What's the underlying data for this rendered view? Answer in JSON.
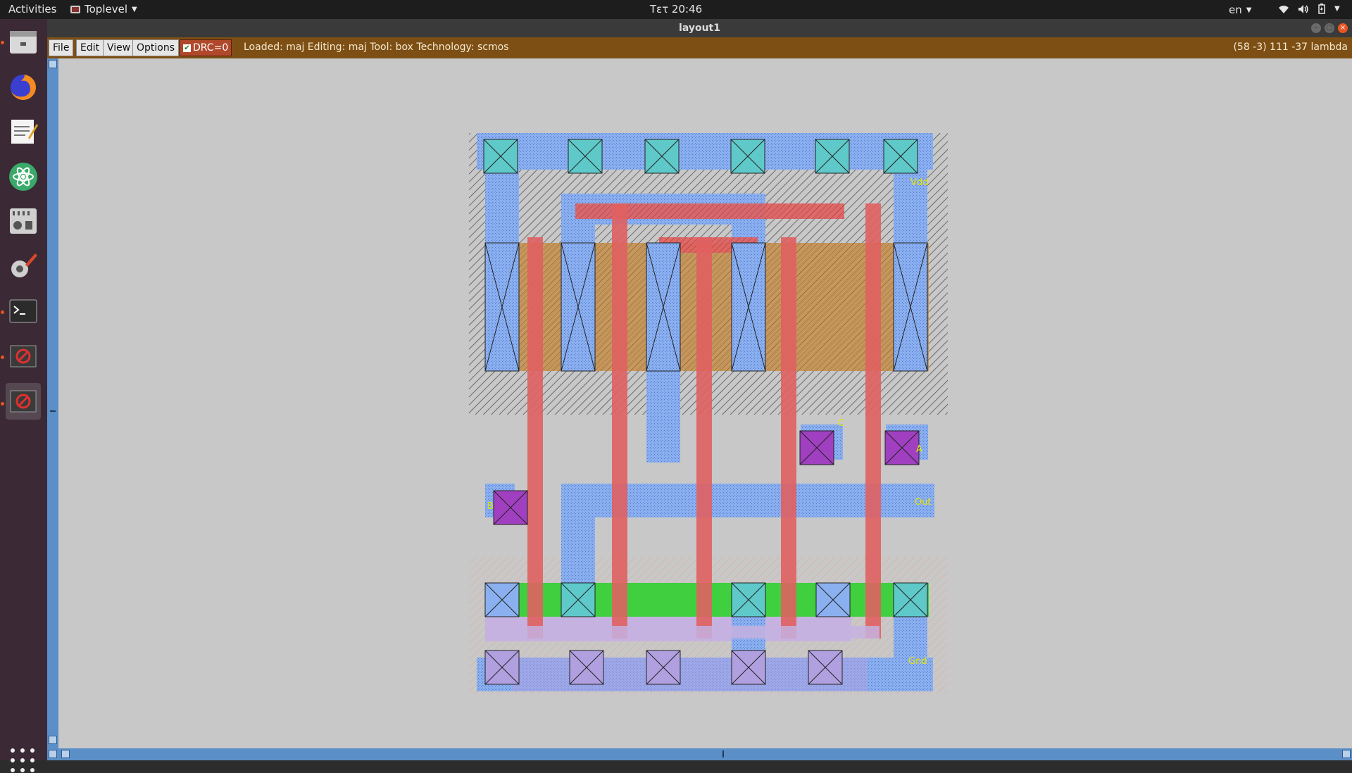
{
  "topbar": {
    "activities": "Activities",
    "app_name": "Toplevel",
    "clock": "Τετ 20:46",
    "language": "en"
  },
  "dock": {
    "items": [
      "files-icon",
      "firefox-icon",
      "text-editor-icon",
      "atom-icon",
      "mixer-icon",
      "settings-icon",
      "terminal-icon",
      "magic-icon",
      "magic-active-icon"
    ]
  },
  "window": {
    "title": "layout1"
  },
  "menubar": {
    "file": "File",
    "edit": "Edit",
    "view": "View",
    "options": "Options",
    "drc": "DRC=0",
    "status": "Loaded: maj Editing: maj Tool: box  Technology: scmos",
    "coords": "(58 -3) 111 -37 lambda"
  },
  "layout_labels": {
    "vdd": "Vdd",
    "gnd": "Gnd",
    "out": "Out",
    "a": "A",
    "b": "B",
    "c": "C"
  },
  "colors": {
    "metal1": "#8ab0f0",
    "poly": "#e06060",
    "pdiff": "#c7904a",
    "ndiff": "#3fcf3f",
    "contact": "#5fc9c9",
    "via": "#a040c0",
    "menubar": "#7d4f14",
    "scrollbar": "#5b8fc7"
  }
}
